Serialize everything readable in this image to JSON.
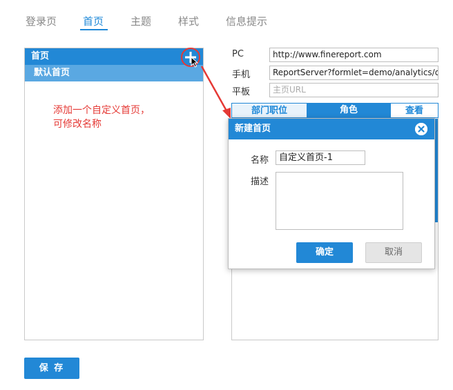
{
  "tabs": [
    {
      "label": "登录页"
    },
    {
      "label": "首页"
    },
    {
      "label": "主题"
    },
    {
      "label": "样式"
    },
    {
      "label": "信息提示"
    }
  ],
  "left_panel": {
    "header": "首页",
    "items": [
      "默认首页"
    ]
  },
  "annotation": "添加一个自定义首页，可修改名称",
  "fields": {
    "pc_label": "PC",
    "pc_value": "http://www.finereport.com",
    "mobile_label": "手机",
    "mobile_value": "ReportServer?formlet=demo/analytics/ope...",
    "tablet_label": "平板",
    "tablet_placeholder": "主页URL"
  },
  "right_tabs": [
    "部门职位",
    "角色",
    "查看"
  ],
  "dialog": {
    "title": "新建首页",
    "name_label": "名称",
    "name_value": "自定义首页-1",
    "desc_label": "描述",
    "ok": "确定",
    "cancel": "取消"
  },
  "save": "保 存",
  "colors": {
    "accent": "#2288d6",
    "highlight": "#e53935"
  }
}
